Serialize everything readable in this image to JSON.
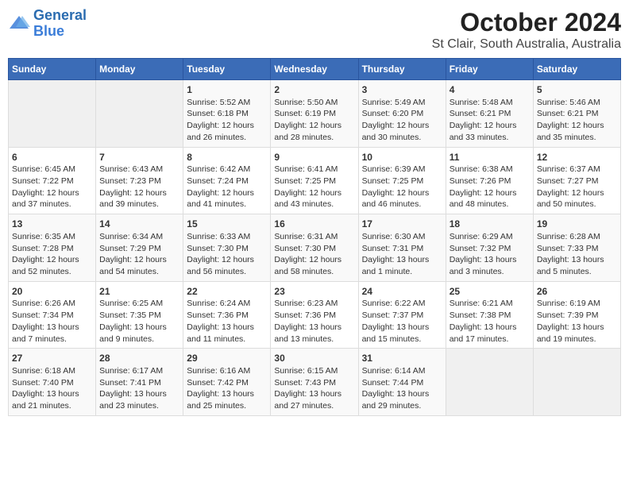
{
  "logo": {
    "line1": "General",
    "line2": "Blue"
  },
  "title": "October 2024",
  "subtitle": "St Clair, South Australia, Australia",
  "days_of_week": [
    "Sunday",
    "Monday",
    "Tuesday",
    "Wednesday",
    "Thursday",
    "Friday",
    "Saturday"
  ],
  "weeks": [
    [
      {
        "day": "",
        "info": ""
      },
      {
        "day": "",
        "info": ""
      },
      {
        "day": "1",
        "info": "Sunrise: 5:52 AM\nSunset: 6:18 PM\nDaylight: 12 hours\nand 26 minutes."
      },
      {
        "day": "2",
        "info": "Sunrise: 5:50 AM\nSunset: 6:19 PM\nDaylight: 12 hours\nand 28 minutes."
      },
      {
        "day": "3",
        "info": "Sunrise: 5:49 AM\nSunset: 6:20 PM\nDaylight: 12 hours\nand 30 minutes."
      },
      {
        "day": "4",
        "info": "Sunrise: 5:48 AM\nSunset: 6:21 PM\nDaylight: 12 hours\nand 33 minutes."
      },
      {
        "day": "5",
        "info": "Sunrise: 5:46 AM\nSunset: 6:21 PM\nDaylight: 12 hours\nand 35 minutes."
      }
    ],
    [
      {
        "day": "6",
        "info": "Sunrise: 6:45 AM\nSunset: 7:22 PM\nDaylight: 12 hours\nand 37 minutes."
      },
      {
        "day": "7",
        "info": "Sunrise: 6:43 AM\nSunset: 7:23 PM\nDaylight: 12 hours\nand 39 minutes."
      },
      {
        "day": "8",
        "info": "Sunrise: 6:42 AM\nSunset: 7:24 PM\nDaylight: 12 hours\nand 41 minutes."
      },
      {
        "day": "9",
        "info": "Sunrise: 6:41 AM\nSunset: 7:25 PM\nDaylight: 12 hours\nand 43 minutes."
      },
      {
        "day": "10",
        "info": "Sunrise: 6:39 AM\nSunset: 7:25 PM\nDaylight: 12 hours\nand 46 minutes."
      },
      {
        "day": "11",
        "info": "Sunrise: 6:38 AM\nSunset: 7:26 PM\nDaylight: 12 hours\nand 48 minutes."
      },
      {
        "day": "12",
        "info": "Sunrise: 6:37 AM\nSunset: 7:27 PM\nDaylight: 12 hours\nand 50 minutes."
      }
    ],
    [
      {
        "day": "13",
        "info": "Sunrise: 6:35 AM\nSunset: 7:28 PM\nDaylight: 12 hours\nand 52 minutes."
      },
      {
        "day": "14",
        "info": "Sunrise: 6:34 AM\nSunset: 7:29 PM\nDaylight: 12 hours\nand 54 minutes."
      },
      {
        "day": "15",
        "info": "Sunrise: 6:33 AM\nSunset: 7:30 PM\nDaylight: 12 hours\nand 56 minutes."
      },
      {
        "day": "16",
        "info": "Sunrise: 6:31 AM\nSunset: 7:30 PM\nDaylight: 12 hours\nand 58 minutes."
      },
      {
        "day": "17",
        "info": "Sunrise: 6:30 AM\nSunset: 7:31 PM\nDaylight: 13 hours\nand 1 minute."
      },
      {
        "day": "18",
        "info": "Sunrise: 6:29 AM\nSunset: 7:32 PM\nDaylight: 13 hours\nand 3 minutes."
      },
      {
        "day": "19",
        "info": "Sunrise: 6:28 AM\nSunset: 7:33 PM\nDaylight: 13 hours\nand 5 minutes."
      }
    ],
    [
      {
        "day": "20",
        "info": "Sunrise: 6:26 AM\nSunset: 7:34 PM\nDaylight: 13 hours\nand 7 minutes."
      },
      {
        "day": "21",
        "info": "Sunrise: 6:25 AM\nSunset: 7:35 PM\nDaylight: 13 hours\nand 9 minutes."
      },
      {
        "day": "22",
        "info": "Sunrise: 6:24 AM\nSunset: 7:36 PM\nDaylight: 13 hours\nand 11 minutes."
      },
      {
        "day": "23",
        "info": "Sunrise: 6:23 AM\nSunset: 7:36 PM\nDaylight: 13 hours\nand 13 minutes."
      },
      {
        "day": "24",
        "info": "Sunrise: 6:22 AM\nSunset: 7:37 PM\nDaylight: 13 hours\nand 15 minutes."
      },
      {
        "day": "25",
        "info": "Sunrise: 6:21 AM\nSunset: 7:38 PM\nDaylight: 13 hours\nand 17 minutes."
      },
      {
        "day": "26",
        "info": "Sunrise: 6:19 AM\nSunset: 7:39 PM\nDaylight: 13 hours\nand 19 minutes."
      }
    ],
    [
      {
        "day": "27",
        "info": "Sunrise: 6:18 AM\nSunset: 7:40 PM\nDaylight: 13 hours\nand 21 minutes."
      },
      {
        "day": "28",
        "info": "Sunrise: 6:17 AM\nSunset: 7:41 PM\nDaylight: 13 hours\nand 23 minutes."
      },
      {
        "day": "29",
        "info": "Sunrise: 6:16 AM\nSunset: 7:42 PM\nDaylight: 13 hours\nand 25 minutes."
      },
      {
        "day": "30",
        "info": "Sunrise: 6:15 AM\nSunset: 7:43 PM\nDaylight: 13 hours\nand 27 minutes."
      },
      {
        "day": "31",
        "info": "Sunrise: 6:14 AM\nSunset: 7:44 PM\nDaylight: 13 hours\nand 29 minutes."
      },
      {
        "day": "",
        "info": ""
      },
      {
        "day": "",
        "info": ""
      }
    ]
  ]
}
